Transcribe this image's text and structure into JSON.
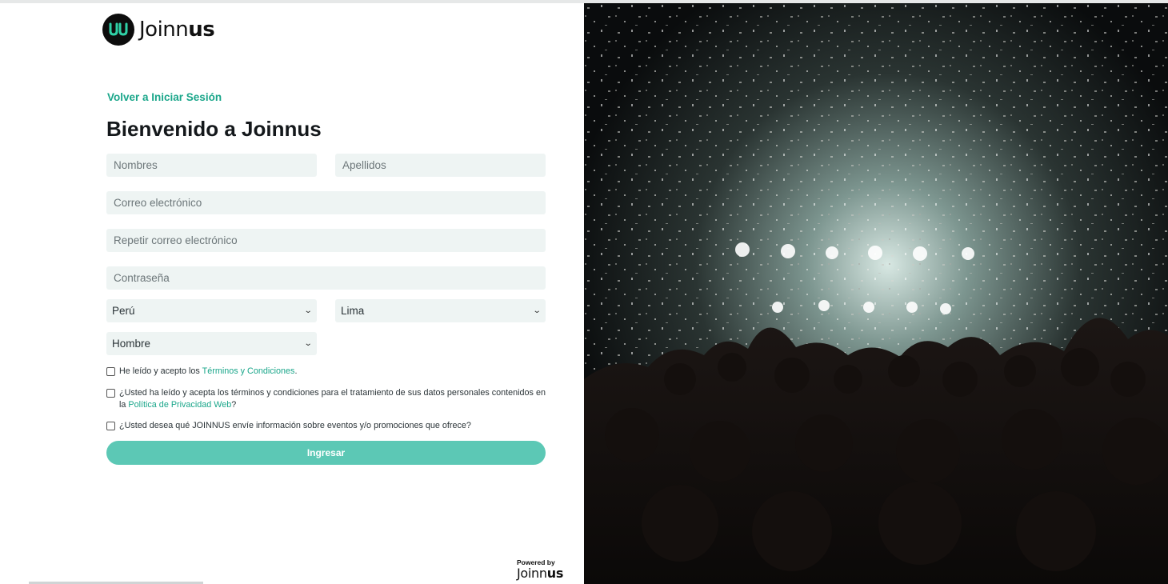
{
  "brand": {
    "logo_mark": "JU",
    "name_light": "Joinn",
    "name_bold": "us"
  },
  "back_link": "Volver a Iniciar Sesión",
  "title": "Bienvenido a Joinnus",
  "form": {
    "first_name_placeholder": "Nombres",
    "last_name_placeholder": "Apellidos",
    "email_placeholder": "Correo electrónico",
    "email_repeat_placeholder": "Repetir correo electrónico",
    "password_placeholder": "Contraseña",
    "country_value": "Perú",
    "city_value": "Lima",
    "gender_value": "Hombre",
    "checks": [
      {
        "before": "He leído y acepto los ",
        "link": "Términos y Condiciones",
        "after": "."
      },
      {
        "before": "¿Usted ha leído y acepta los términos y condiciones para el tratamiento de sus datos personales contenidos en la ",
        "link": "Política de Privacidad Web",
        "after": "?"
      },
      {
        "before": "¿Usted desea qué JOINNUS envíe información sobre eventos y/o promociones que ofrece?",
        "link": "",
        "after": ""
      }
    ],
    "submit_label": "Ingresar"
  },
  "footer": {
    "powered_by": "Powered by",
    "logo_light": "Joinn",
    "logo_bold": "us"
  },
  "hero_image": {
    "subject": "concert crowd with confetti and stage lights"
  },
  "colors": {
    "accent": "#1aa68a",
    "button": "#5cc8b5",
    "field_bg": "#eef4f3"
  },
  "icons": {
    "select_arrow": "chevron-down-icon"
  }
}
